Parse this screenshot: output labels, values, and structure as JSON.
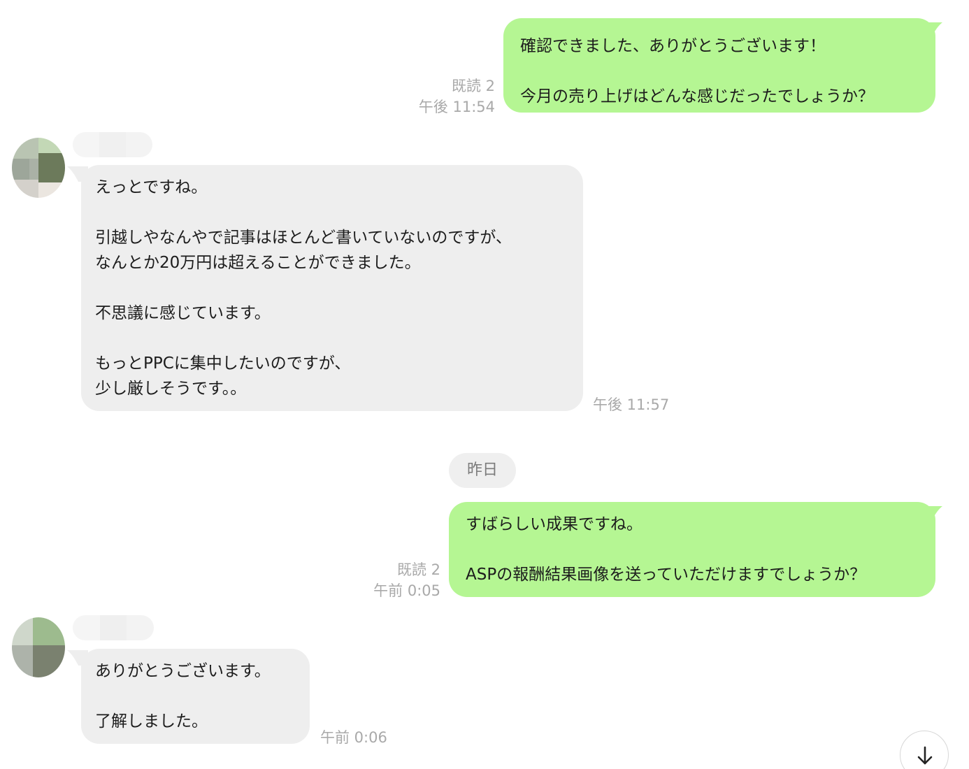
{
  "colors": {
    "outgoing_bubble": "#b5f693",
    "incoming_bubble": "#eeeeee",
    "meta_text": "#a9a9a9"
  },
  "messages": [
    {
      "direction": "out",
      "text": "確認できました、ありがとうございます！\n\n今月の売り上げはどんな感じだったでしょうか？",
      "read": "既読 2",
      "time": "午後 11:54"
    },
    {
      "direction": "in",
      "text": "えっとですね。\n\n引越しやなんやで記事はほとんど書いていないのですが、\nなんとか20万円は超えることができました。\n\n不思議に感じています。\n\nもっとPPCに集中したいのですが、\n少し厳しそうです。。",
      "time": "午後 11:57"
    },
    {
      "direction": "out",
      "text": "すばらしい成果ですね。\n\nASPの報酬結果画像を送っていただけますでしょうか？",
      "read": "既読 2",
      "time": "午前 0:05"
    },
    {
      "direction": "in",
      "text": "ありがとうございます。\n\n了解しました。",
      "time": "午前 0:06"
    }
  ],
  "date_divider": "昨日",
  "scroll_button": {
    "icon": "arrow-down-icon"
  }
}
